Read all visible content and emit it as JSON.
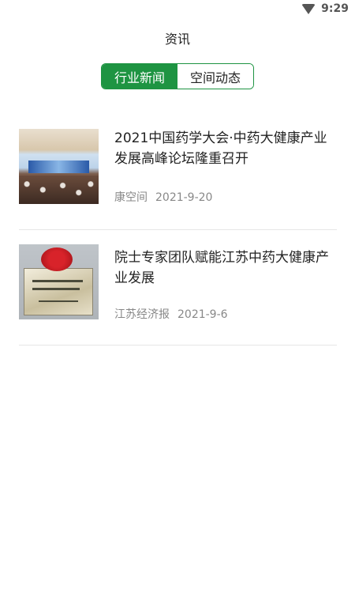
{
  "status_bar": {
    "time": "9:29",
    "wifi_icon": "wifi-icon"
  },
  "header": {
    "title": "资讯"
  },
  "tabs": [
    {
      "label": "行业新闻",
      "active": true
    },
    {
      "label": "空间动态",
      "active": false
    }
  ],
  "colors": {
    "accent": "#1e9442",
    "divider": "#e6e6e6",
    "meta_text": "#888888"
  },
  "news": [
    {
      "title": "2021中国药学大会·中药大健康产业发展高峰论坛隆重召开",
      "source": "康空间",
      "date": "2021-9-20",
      "thumbnail": "conference-photo"
    },
    {
      "title": "院士专家团队赋能江苏中药大健康产业发展",
      "source": "江苏经济报",
      "date": "2021-9-6",
      "thumbnail": "plaque-photo"
    }
  ]
}
